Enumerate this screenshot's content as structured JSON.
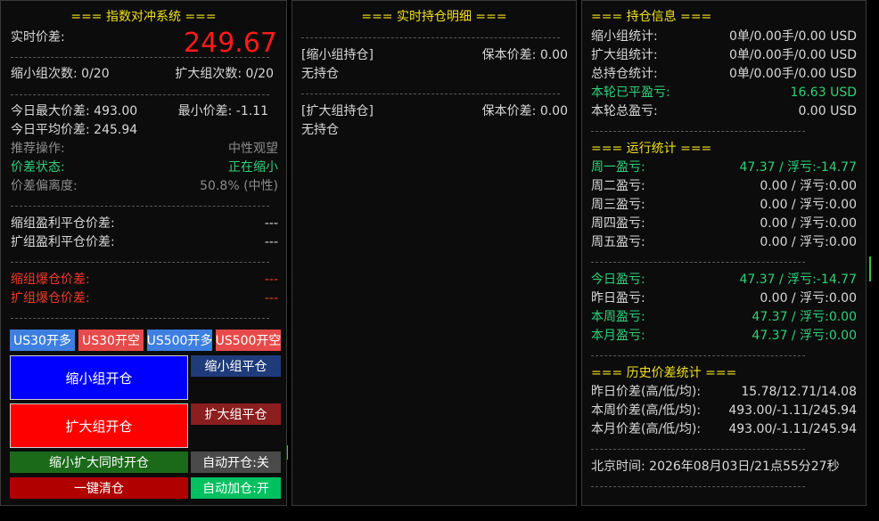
{
  "left": {
    "title": "=== 指数对冲系统 ===",
    "price_label": "实时价差:",
    "price_value": "249.67",
    "sep": "-----------------------------------------------",
    "shrink_count": "缩小组次数: 0/20",
    "expand_count": "扩大组次数: 0/20",
    "today_max": "今日最大价差: 493.00",
    "today_min": "最小价差: -1.11",
    "today_avg": "今日平均价差: 245.94",
    "recommend_label": "推荐操作:",
    "recommend_value": "中性观望",
    "state_label": "价差状态:",
    "state_value": "正在缩小",
    "deviation_label": "价差偏离度:",
    "deviation_value": "50.8% (中性)",
    "shrink_profit_label": "缩组盈利平仓价差:",
    "shrink_profit_value": "---",
    "expand_profit_label": "扩组盈利平仓价差:",
    "expand_profit_value": "---",
    "shrink_liq_label": "缩组爆仓价差:",
    "shrink_liq_value": "---",
    "expand_liq_label": "扩组爆仓价差:",
    "expand_liq_value": "---",
    "buttons": {
      "us30_long": "US30开多",
      "us30_short": "US30开空",
      "us500_long": "US500开多",
      "us500_short": "US500开空",
      "shrink_open": "缩小组开仓",
      "shrink_close": "缩小组平仓",
      "expand_open": "扩大组开仓",
      "expand_close": "扩大组平仓",
      "both_open": "缩小扩大同时开仓",
      "auto_open": "自动开仓:关",
      "clear_all": "一键清仓",
      "auto_add": "自动加仓:开"
    }
  },
  "middle": {
    "title": "=== 实时持仓明细 ===",
    "sep": "--------------------------------------------------",
    "shrink_header": "[缩小组持仓]",
    "shrink_breakeven": "保本价差: 0.00",
    "shrink_empty": "无持仓",
    "expand_header": "[扩大组持仓]",
    "expand_breakeven": "保本价差: 0.00",
    "expand_empty": "无持仓"
  },
  "right": {
    "title": "=== 持仓信息 ===",
    "sep": "----------------------------------------",
    "rows_info": [
      {
        "label": "缩小组统计:",
        "value": "0单/0.00手/0.00 USD"
      },
      {
        "label": "扩大组统计:",
        "value": "0单/0.00手/0.00 USD"
      },
      {
        "label": "总持仓统计:",
        "value": "0单/0.00手/0.00 USD"
      },
      {
        "label": "本轮已平盈亏:",
        "value": "16.63 USD"
      },
      {
        "label": "本轮总盈亏:",
        "value": "0.00 USD"
      }
    ],
    "run_title": "=== 运行统计 ===",
    "rows_week": [
      {
        "label": "周一盈亏:",
        "value": "47.37 / 浮亏:-14.77"
      },
      {
        "label": "周二盈亏:",
        "value": "0.00 / 浮亏:0.00"
      },
      {
        "label": "周三盈亏:",
        "value": "0.00 / 浮亏:0.00"
      },
      {
        "label": "周四盈亏:",
        "value": "0.00 / 浮亏:0.00"
      },
      {
        "label": "周五盈亏:",
        "value": "0.00 / 浮亏:0.00"
      }
    ],
    "rows_period": [
      {
        "label": "今日盈亏:",
        "value": "47.37 / 浮亏:-14.77"
      },
      {
        "label": "昨日盈亏:",
        "value": "0.00 / 浮亏:0.00"
      },
      {
        "label": "本周盈亏:",
        "value": "47.37 / 浮亏:0.00"
      },
      {
        "label": "本月盈亏:",
        "value": "47.37 / 浮亏:0.00"
      }
    ],
    "hist_title": "=== 历史价差统计 ===",
    "rows_hist": [
      {
        "label": "昨日价差(高/低/均):",
        "value": "15.78/12.71/14.08"
      },
      {
        "label": "本周价差(高/低/均):",
        "value": "493.00/-1.11/245.94"
      },
      {
        "label": "本月价差(高/低/均):",
        "value": "493.00/-1.11/245.94"
      }
    ],
    "time": "北京时间: 2026年08月03日/21点55分27秒"
  },
  "colors": {
    "title": "#f0e020",
    "positive": "#2fd07a",
    "danger": "#f23a2a",
    "price": "#ff1a1a"
  }
}
